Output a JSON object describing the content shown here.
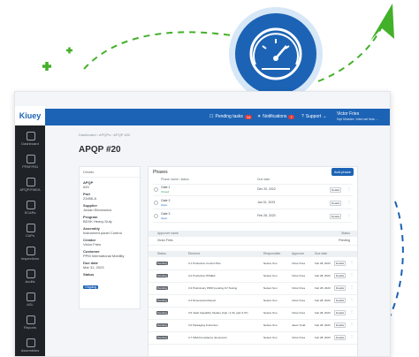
{
  "colors": {
    "brand": "#1c63b5",
    "arrow_green": "#43b02a",
    "sidebar": "#1f2328",
    "gauge_ring": "#1c63b5"
  },
  "logo": {
    "text": "Kiuey"
  },
  "icons": {
    "gauge": "speedometer-icon",
    "plus": "plus-icon",
    "arrow": "green-arrow"
  },
  "sidebar": {
    "items": [
      {
        "label": "Dashboard",
        "icon": "dashboard-icon"
      },
      {
        "label": "PPAP/FAI",
        "icon": "ppap-icon"
      },
      {
        "label": "APQP/FMEA",
        "icon": "apqp-icon"
      },
      {
        "label": "SCARs",
        "icon": "scar-icon"
      },
      {
        "label": "CAPs",
        "icon": "caps-icon"
      },
      {
        "label": "Inspections",
        "icon": "inspection-icon"
      },
      {
        "label": "Audits",
        "icon": "audit-icon"
      },
      {
        "label": "ASL",
        "icon": "asl-icon"
      },
      {
        "label": "Reports",
        "icon": "reports-icon"
      },
      {
        "label": "Assemblies",
        "icon": "assemblies-icon"
      }
    ]
  },
  "topbar": {
    "pending_label": "Pending tasks",
    "pending_count": "14",
    "notifications_label": "Notifications",
    "notifications_count": "7",
    "support_label": "Support",
    "user_name": "Victor Fries",
    "user_sub": "Npi Master: Internal lists ..."
  },
  "breadcrumb": "Dashboard  ›  APQPs  ›  APQP #20",
  "page_title": "APQP #20",
  "details": {
    "header": "Details",
    "fields": [
      {
        "label": "APQP",
        "value": "#20"
      },
      {
        "label": "Part",
        "value": "23456-A"
      },
      {
        "label": "Supplier",
        "value": "Jovian Electronics"
      },
      {
        "label": "Program",
        "value": "BDXK Heavy Duty"
      },
      {
        "label": "Assembly",
        "value": "Instrument panel Control"
      },
      {
        "label": "Creator",
        "value": "Victor Fries"
      },
      {
        "label": "Customer",
        "value": "PPM International Mobility"
      },
      {
        "label": "Due date",
        "value": "Mar 31, 2023"
      }
    ],
    "status_label": "Status",
    "status_value": "Ongoing"
  },
  "phases": {
    "title": "Phases",
    "add_label": "Add phase",
    "col_name": "Phase name / status",
    "col_due": "Due date",
    "details_label": "Details",
    "rows": [
      {
        "name": "Gate 1",
        "status": "Closed",
        "due": "Dec 20, 2022"
      },
      {
        "name": "Gate 2",
        "status": "Open",
        "due": "Jan 31, 2023"
      },
      {
        "name": "Gate 3",
        "status": "Open",
        "due": "Feb 28, 2023"
      }
    ]
  },
  "approver": {
    "header": "Approver name",
    "status_header": "Status",
    "name": "Victor Fries",
    "status": "Pending"
  },
  "elements": {
    "headers": {
      "status": "Status",
      "element": "Element",
      "responsible": "Responsible",
      "approver": "Approver",
      "due": "Due date"
    },
    "rows": [
      {
        "status": "Pending",
        "element": "3.1 Production Control Plan",
        "responsible": "Nelson Sun",
        "approver": "Victor Fries",
        "due": "Feb 28, 2023"
      },
      {
        "status": "Pending",
        "element": "3.2 Production PFMEA",
        "responsible": "Nelson Sun",
        "approver": "Victor Fries",
        "due": "Feb 28, 2023"
      },
      {
        "status": "Pending",
        "element": "3.3 Preliminary PPAP pending FV Testing",
        "responsible": "Nelson Sun",
        "approver": "Victor Fries",
        "due": "Feb 28, 2023"
      },
      {
        "status": "Pending",
        "element": "3.4 Dimensional Report",
        "responsible": "Nelson Sun",
        "approver": "Victor Fries",
        "due": "Feb 28, 2023"
      },
      {
        "status": "Pending",
        "element": "3.5 Initial Capability Studies (Cpk >1.33, ppk>1.67)",
        "responsible": "Nelson Sun",
        "approver": "Victor Fries",
        "due": "Feb 28, 2023"
      },
      {
        "status": "Pending",
        "element": "3.6 Packaging Instruction",
        "responsible": "Nelson Sun",
        "approver": "Jason Todd",
        "due": "Feb 28, 2023"
      },
      {
        "status": "Pending",
        "element": "3.7 MSA/Compliance documents",
        "responsible": "Nelson Sun",
        "approver": "Victor Fries",
        "due": "Feb 28, 2023"
      }
    ]
  }
}
